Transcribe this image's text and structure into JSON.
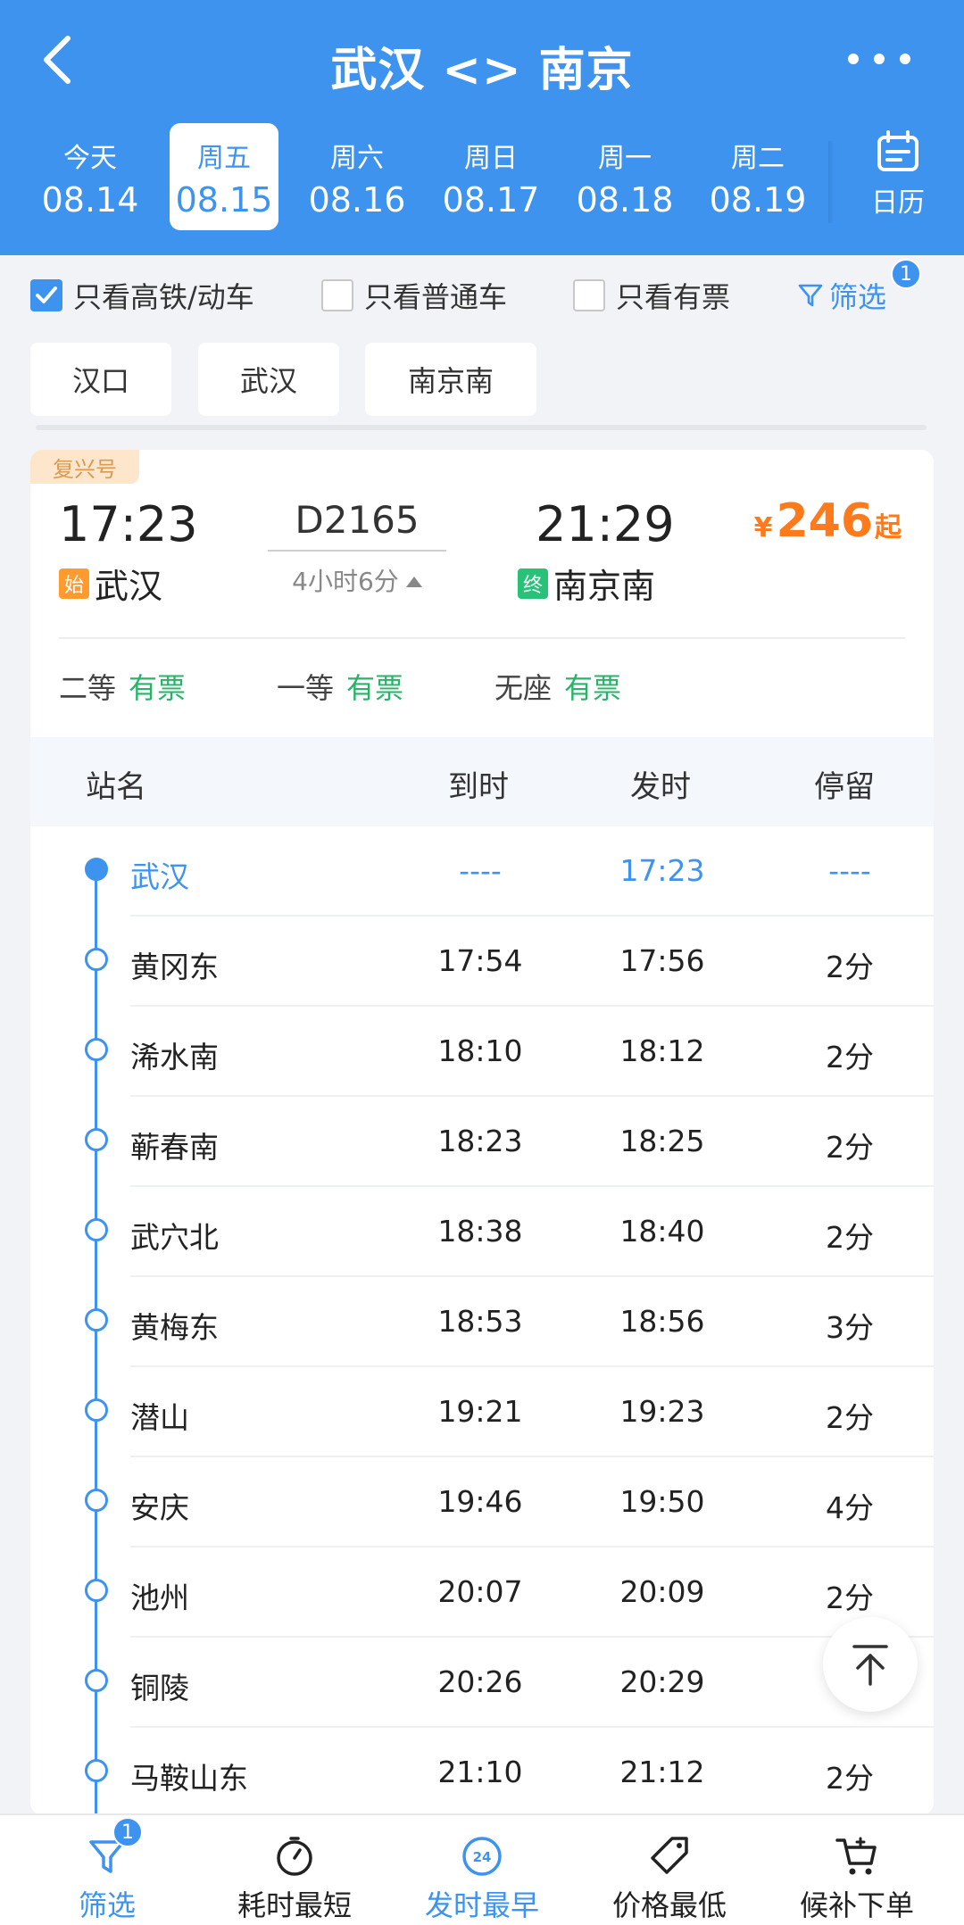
{
  "header": {
    "title": "武汉 <> 南京",
    "dates": [
      {
        "weekday": "今天",
        "date": "08.14"
      },
      {
        "weekday": "周五",
        "date": "08.15"
      },
      {
        "weekday": "周六",
        "date": "08.16"
      },
      {
        "weekday": "周日",
        "date": "08.17"
      },
      {
        "weekday": "周一",
        "date": "08.18"
      },
      {
        "weekday": "周二",
        "date": "08.19"
      }
    ],
    "selected_index": 1,
    "calendar_label": "日历"
  },
  "filters": {
    "high_speed_label": "只看高铁/动车",
    "high_speed_checked": true,
    "normal_label": "只看普通车",
    "normal_checked": false,
    "available_label": "只看有票",
    "available_checked": false,
    "filter_label": "筛选",
    "filter_badge": "1"
  },
  "stations": [
    "汉口",
    "武汉",
    "南京南"
  ],
  "train": {
    "tag": "复兴号",
    "depart_time": "17:23",
    "arrive_time": "21:29",
    "number": "D2165",
    "duration": "4小时6分",
    "price_symbol": "¥",
    "price": "246",
    "price_suffix": "起",
    "from_mark": "始",
    "from_station": "武汉",
    "to_mark": "终",
    "to_station": "南京南",
    "seats": [
      {
        "class": "二等",
        "status": "有票"
      },
      {
        "class": "一等",
        "status": "有票"
      },
      {
        "class": "无座",
        "status": "有票"
      }
    ]
  },
  "table": {
    "headers": [
      "站名",
      "到时",
      "发时",
      "停留"
    ],
    "rows": [
      {
        "name": "武汉",
        "arrive": "----",
        "depart": "17:23",
        "stay": "----"
      },
      {
        "name": "黄冈东",
        "arrive": "17:54",
        "depart": "17:56",
        "stay": "2分"
      },
      {
        "name": "浠水南",
        "arrive": "18:10",
        "depart": "18:12",
        "stay": "2分"
      },
      {
        "name": "蕲春南",
        "arrive": "18:23",
        "depart": "18:25",
        "stay": "2分"
      },
      {
        "name": "武穴北",
        "arrive": "18:38",
        "depart": "18:40",
        "stay": "2分"
      },
      {
        "name": "黄梅东",
        "arrive": "18:53",
        "depart": "18:56",
        "stay": "3分"
      },
      {
        "name": "潜山",
        "arrive": "19:21",
        "depart": "19:23",
        "stay": "2分"
      },
      {
        "name": "安庆",
        "arrive": "19:46",
        "depart": "19:50",
        "stay": "4分"
      },
      {
        "name": "池州",
        "arrive": "20:07",
        "depart": "20:09",
        "stay": "2分"
      },
      {
        "name": "铜陵",
        "arrive": "20:26",
        "depart": "20:29",
        "stay": ""
      },
      {
        "name": "马鞍山东",
        "arrive": "21:10",
        "depart": "21:12",
        "stay": "2分"
      }
    ]
  },
  "bottom_bar": {
    "items": [
      {
        "label": "筛选",
        "badge": "1"
      },
      {
        "label": "耗时最短"
      },
      {
        "label": "发时最早",
        "icon_text": "24"
      },
      {
        "label": "价格最低"
      },
      {
        "label": "候补下单"
      }
    ]
  },
  "colors": {
    "primary": "#3d93ee",
    "price": "#ff7a1a",
    "available": "#29b36a",
    "tag_bg": "#fde6cc",
    "tag_text": "#d99a52"
  }
}
